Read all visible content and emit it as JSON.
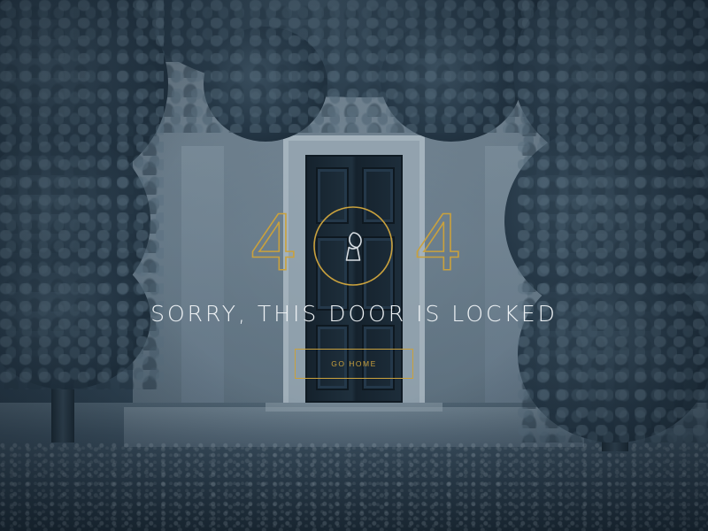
{
  "error": {
    "code_left_digit": "4",
    "code_right_digit": "4",
    "icon": "keyhole-icon",
    "message": "SORRY, THIS DOOR IS LOCKED"
  },
  "actions": {
    "go_home_label": "GO HOME"
  },
  "colors": {
    "accent": "#c9a13d",
    "text": "#eef2f5",
    "background_tint": "#2c3f4e"
  }
}
